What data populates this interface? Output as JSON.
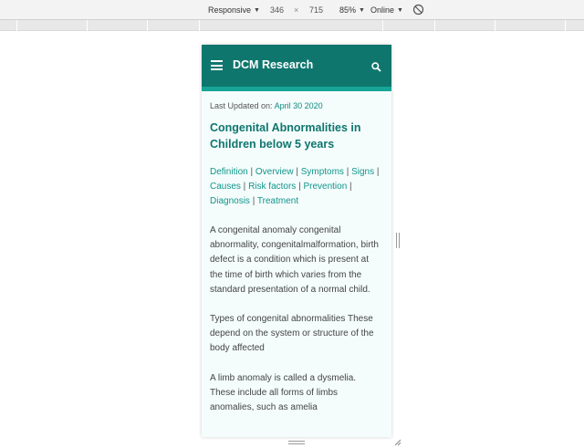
{
  "devtools": {
    "device_mode": "Responsive",
    "width": "346",
    "separator": "×",
    "height": "715",
    "zoom": "85%",
    "network": "Online"
  },
  "app": {
    "brand": "DCM Research",
    "accent_color": "#0f766e",
    "stripe_color": "#16a597",
    "icons": [
      "menu-icon",
      "search-icon"
    ]
  },
  "article": {
    "updated_label": "Last Updated on:",
    "updated_date": "April 30 2020",
    "title": "Congenital Abnormalities in Children below 5 years",
    "links": [
      "Definition",
      "Overview",
      "Symptoms",
      "Signs",
      "Causes",
      "Risk factors",
      "Prevention",
      "Diagnosis",
      "Treatment"
    ],
    "link_separator": " | ",
    "paragraphs": [
      "A congenital anomaly congenital abnormality, congenitalmalformation, birth defect is a condition which is present at the time of birth which varies from the standard presentation of a normal child.",
      "Types of congenital abnormalities These depend on the system or structure of the body affected",
      "A limb anomaly is called a dysmelia. These include all forms of limbs anomalies, such as amelia"
    ]
  }
}
